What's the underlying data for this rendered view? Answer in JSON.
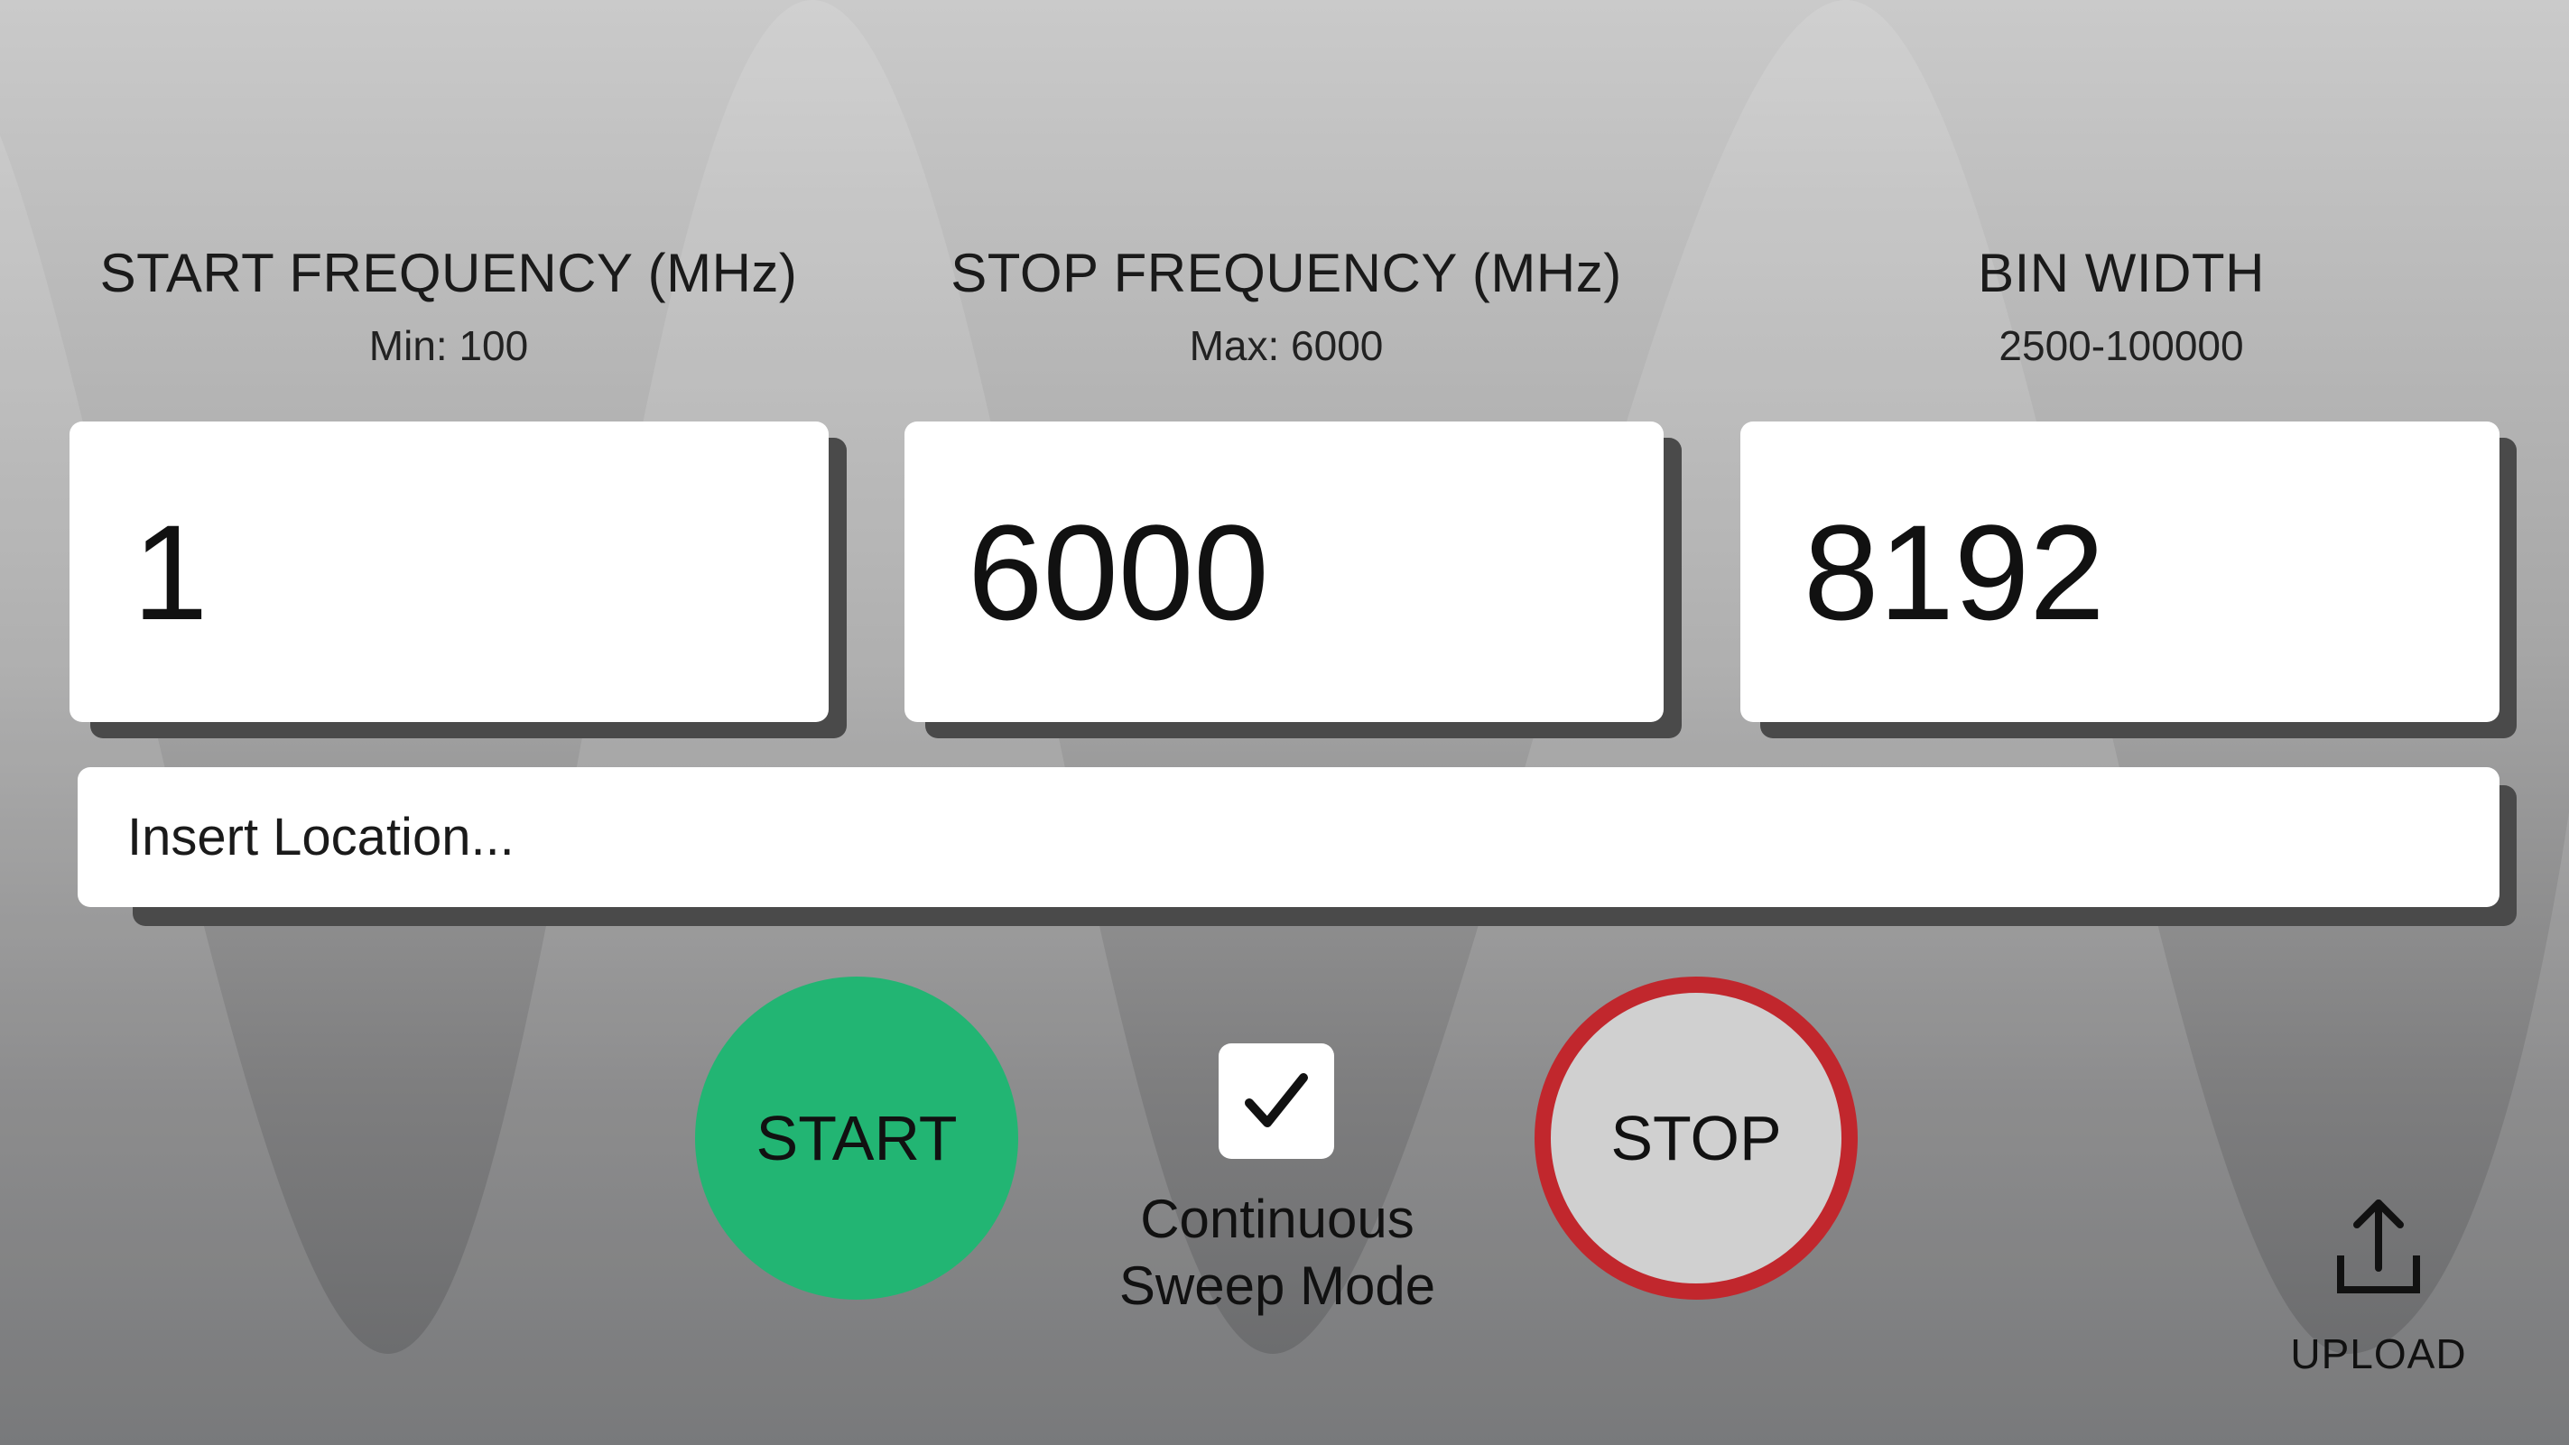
{
  "fields": {
    "start": {
      "title": "START FREQUENCY (MHz)",
      "hint": "Min: 100",
      "value": "1"
    },
    "stop": {
      "title": "STOP FREQUENCY (MHz)",
      "hint": "Max: 6000",
      "value": "6000"
    },
    "bin": {
      "title": "BIN WIDTH",
      "hint": "2500-100000",
      "value": "8192"
    }
  },
  "location": {
    "placeholder": "Insert Location..."
  },
  "controls": {
    "start_label": "START",
    "stop_label": "STOP",
    "sweep_checked": true,
    "sweep_label_line1": "Continuous",
    "sweep_label_line2": "Sweep Mode",
    "upload_label": "UPLOAD"
  },
  "colors": {
    "start_button": "#22b573",
    "stop_ring": "#c1272d",
    "stop_fill": "#d0d0d0"
  },
  "icons": [
    "check-icon",
    "upload-icon",
    "sine-wave-background"
  ]
}
